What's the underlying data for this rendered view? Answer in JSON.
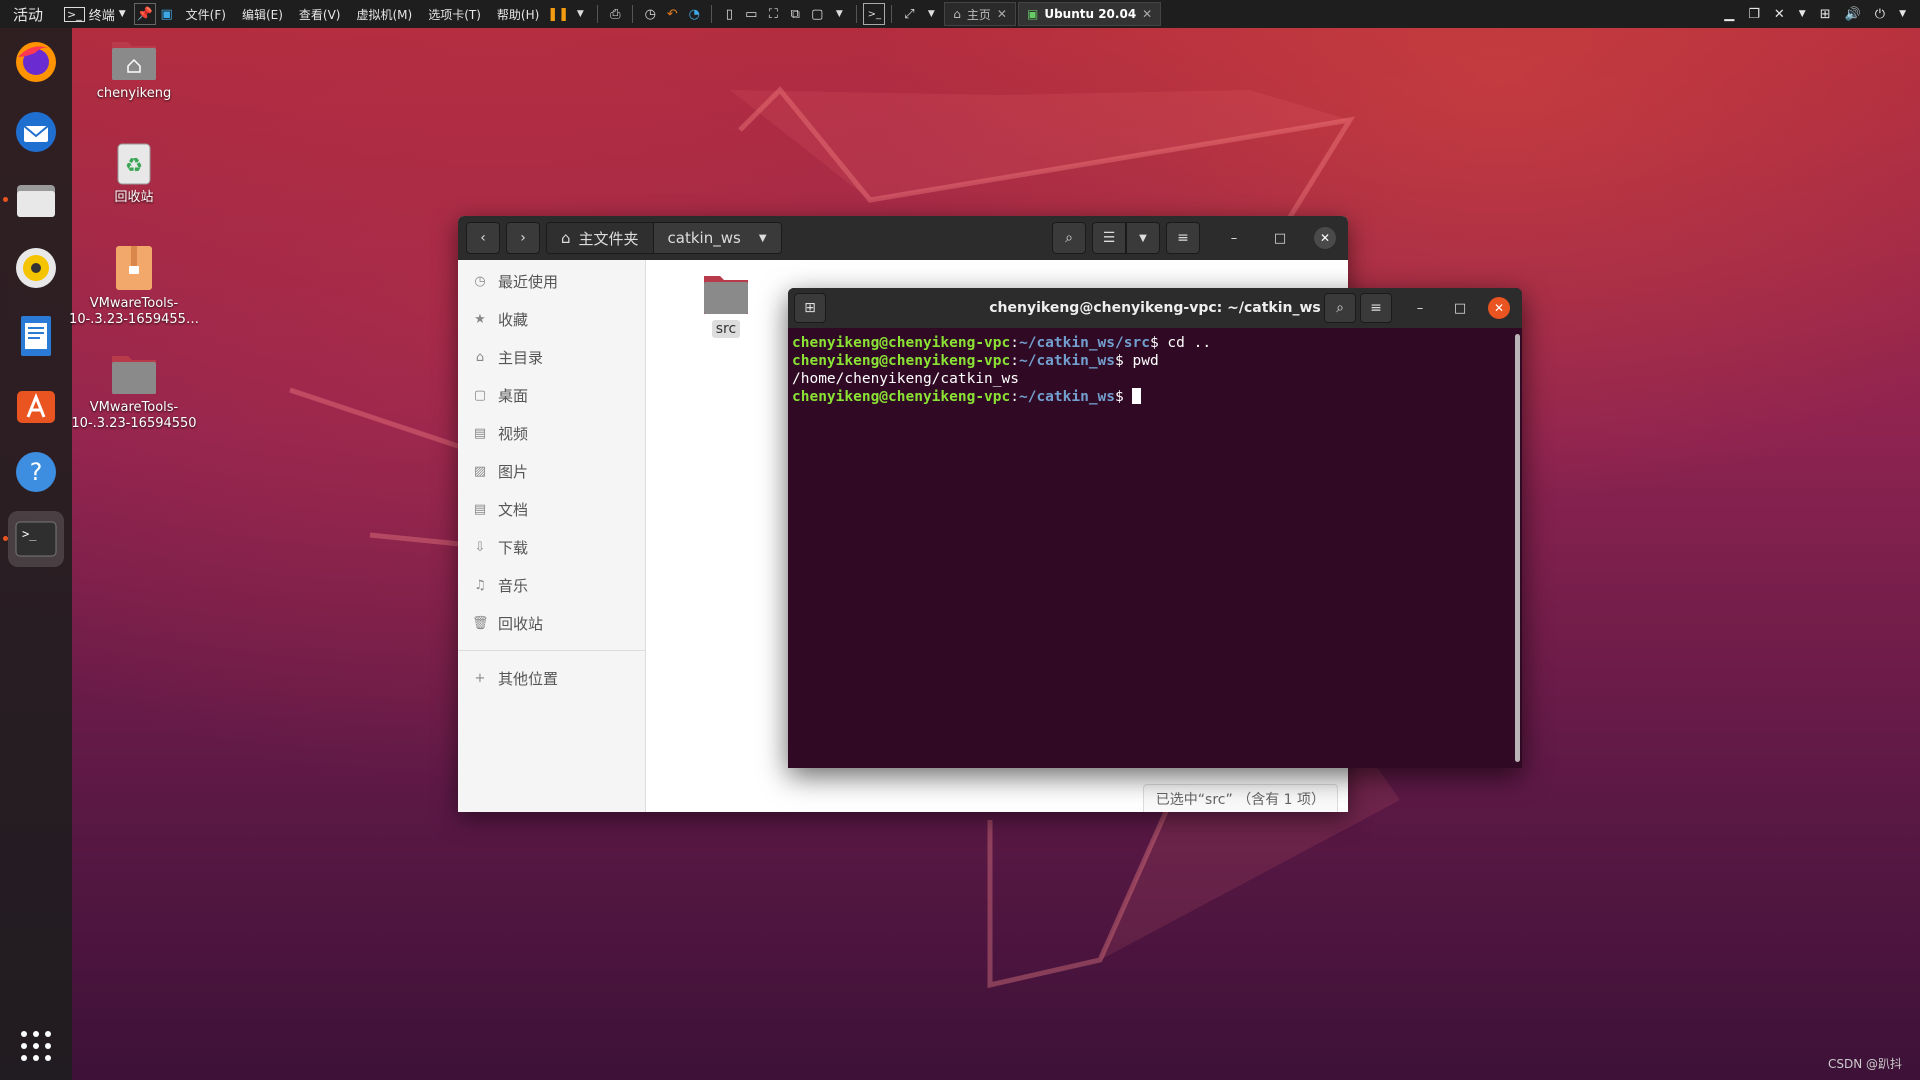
{
  "topbar": {
    "activities": "活动",
    "app_name": "终端",
    "menus": [
      "文件(F)",
      "编辑(E)",
      "查看(V)",
      "虚拟机(M)",
      "选项卡(T)",
      "帮助(H)"
    ],
    "tabs": [
      {
        "label": "主页",
        "active": false
      },
      {
        "label": "Ubuntu 20.04",
        "active": true
      }
    ]
  },
  "dock": {
    "items": [
      {
        "name": "firefox",
        "active": false
      },
      {
        "name": "thunderbird",
        "active": false
      },
      {
        "name": "files",
        "active": false
      },
      {
        "name": "rhythmbox",
        "active": false
      },
      {
        "name": "libreoffice-writer",
        "active": false
      },
      {
        "name": "software-center",
        "active": false
      },
      {
        "name": "help",
        "active": false
      },
      {
        "name": "terminal",
        "active": true
      }
    ],
    "show_apps_icon": "grid-icon"
  },
  "desktop": {
    "icons": [
      {
        "label": "chenyikeng",
        "icon": "home-folder-icon"
      },
      {
        "label": "回收站",
        "icon": "trash-icon"
      },
      {
        "label": "VMwareTools-10-.3.23-1659455…",
        "icon": "archive-icon"
      },
      {
        "label": "VMwareTools-10-.3.23-16594550",
        "icon": "folder-icon"
      }
    ]
  },
  "files": {
    "path": {
      "home": "主文件夹",
      "current": "catkin_ws"
    },
    "sidebar": [
      {
        "label": "最近使用",
        "icon": "clock-icon"
      },
      {
        "label": "收藏",
        "icon": "star-icon"
      },
      {
        "label": "主目录",
        "icon": "home-icon"
      },
      {
        "label": "桌面",
        "icon": "desktop-icon"
      },
      {
        "label": "视频",
        "icon": "video-icon"
      },
      {
        "label": "图片",
        "icon": "image-icon"
      },
      {
        "label": "文档",
        "icon": "document-icon"
      },
      {
        "label": "下载",
        "icon": "download-icon"
      },
      {
        "label": "音乐",
        "icon": "music-icon"
      },
      {
        "label": "回收站",
        "icon": "trash-icon"
      }
    ],
    "other_locations": "其他位置",
    "items": [
      {
        "label": "src",
        "selected": true
      }
    ],
    "status": "已选中“src” （含有 1 项）"
  },
  "terminal": {
    "title": "chenyikeng@chenyikeng-vpc: ~/catkin_ws",
    "lines": [
      {
        "user": "chenyikeng@chenyikeng-vpc",
        "path": "~/catkin_ws/src",
        "cmd": " cd .."
      },
      {
        "user": "chenyikeng@chenyikeng-vpc",
        "path": "~/catkin_ws",
        "cmd": " pwd"
      },
      {
        "output": "/home/chenyikeng/catkin_ws"
      },
      {
        "user": "chenyikeng@chenyikeng-vpc",
        "path": "~/catkin_ws",
        "cmd": " "
      }
    ]
  },
  "watermark": "CSDN @趴抖"
}
